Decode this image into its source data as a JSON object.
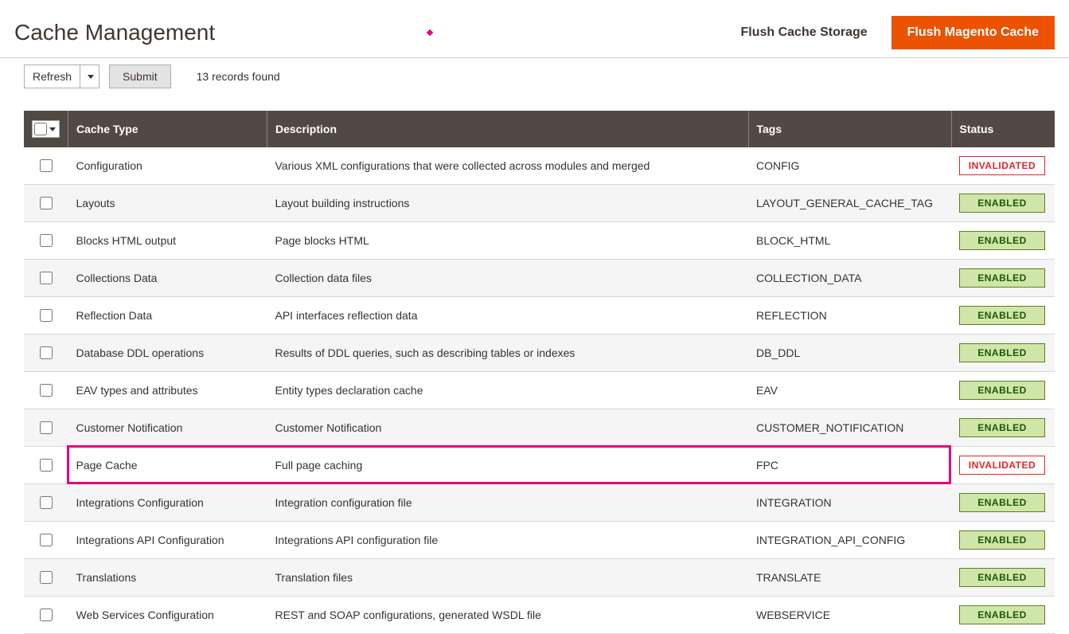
{
  "header": {
    "title": "Cache Management",
    "flush_storage_label": "Flush Cache Storage",
    "flush_magento_label": "Flush Magento Cache"
  },
  "toolbar": {
    "action_label": "Refresh",
    "submit_label": "Submit",
    "records_found": "13 records found"
  },
  "table": {
    "headers": {
      "cache_type": "Cache Type",
      "description": "Description",
      "tags": "Tags",
      "status": "Status"
    },
    "status_labels": {
      "enabled": "ENABLED",
      "invalidated": "INVALIDATED"
    },
    "rows": [
      {
        "type": "Configuration",
        "description": "Various XML configurations that were collected across modules and merged",
        "tags": "CONFIG",
        "status": "invalidated",
        "highlighted": false
      },
      {
        "type": "Layouts",
        "description": "Layout building instructions",
        "tags": "LAYOUT_GENERAL_CACHE_TAG",
        "status": "enabled",
        "highlighted": false
      },
      {
        "type": "Blocks HTML output",
        "description": "Page blocks HTML",
        "tags": "BLOCK_HTML",
        "status": "enabled",
        "highlighted": false
      },
      {
        "type": "Collections Data",
        "description": "Collection data files",
        "tags": "COLLECTION_DATA",
        "status": "enabled",
        "highlighted": false
      },
      {
        "type": "Reflection Data",
        "description": "API interfaces reflection data",
        "tags": "REFLECTION",
        "status": "enabled",
        "highlighted": false
      },
      {
        "type": "Database DDL operations",
        "description": "Results of DDL queries, such as describing tables or indexes",
        "tags": "DB_DDL",
        "status": "enabled",
        "highlighted": false
      },
      {
        "type": "EAV types and attributes",
        "description": "Entity types declaration cache",
        "tags": "EAV",
        "status": "enabled",
        "highlighted": false
      },
      {
        "type": "Customer Notification",
        "description": "Customer Notification",
        "tags": "CUSTOMER_NOTIFICATION",
        "status": "enabled",
        "highlighted": false
      },
      {
        "type": "Page Cache",
        "description": "Full page caching",
        "tags": "FPC",
        "status": "invalidated",
        "highlighted": true
      },
      {
        "type": "Integrations Configuration",
        "description": "Integration configuration file",
        "tags": "INTEGRATION",
        "status": "enabled",
        "highlighted": false
      },
      {
        "type": "Integrations API Configuration",
        "description": "Integrations API configuration file",
        "tags": "INTEGRATION_API_CONFIG",
        "status": "enabled",
        "highlighted": false
      },
      {
        "type": "Translations",
        "description": "Translation files",
        "tags": "TRANSLATE",
        "status": "enabled",
        "highlighted": false
      },
      {
        "type": "Web Services Configuration",
        "description": "REST and SOAP configurations, generated WSDL file",
        "tags": "WEBSERVICE",
        "status": "enabled",
        "highlighted": false
      }
    ]
  }
}
